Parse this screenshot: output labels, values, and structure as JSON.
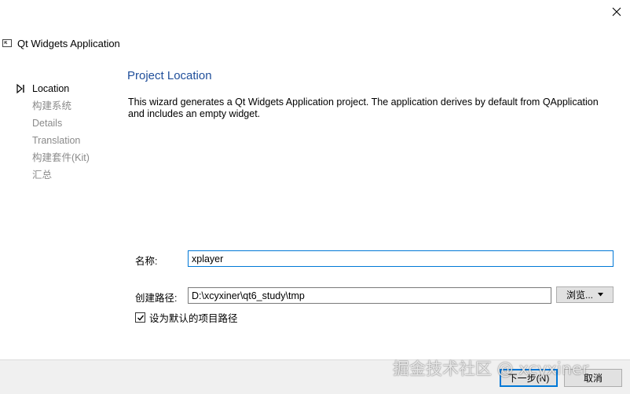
{
  "window": {
    "title": "Qt Widgets Application"
  },
  "steps": [
    {
      "label": "Location",
      "active": true
    },
    {
      "label": "构建系统",
      "active": false
    },
    {
      "label": "Details",
      "active": false
    },
    {
      "label": "Translation",
      "active": false
    },
    {
      "label": "构建套件(Kit)",
      "active": false
    },
    {
      "label": "汇总",
      "active": false
    }
  ],
  "page": {
    "heading": "Project Location",
    "description": "This wizard generates a Qt Widgets Application project. The application derives by default from QApplication and includes an empty widget."
  },
  "form": {
    "name_label": "名称:",
    "name_value": "xplayer",
    "path_label": "创建路径:",
    "path_value": "D:\\xcyxiner\\qt6_study\\tmp",
    "browse_label": "浏览...",
    "default_path_checkbox_label": "设为默认的项目路径",
    "default_path_checked": true
  },
  "buttons": {
    "next_label": "下一步(N)",
    "cancel_label": "取消"
  },
  "watermark": "掘金技术社区 @ xcyxiner",
  "colors": {
    "heading": "#1f4e9a",
    "focus": "#0078d7"
  }
}
